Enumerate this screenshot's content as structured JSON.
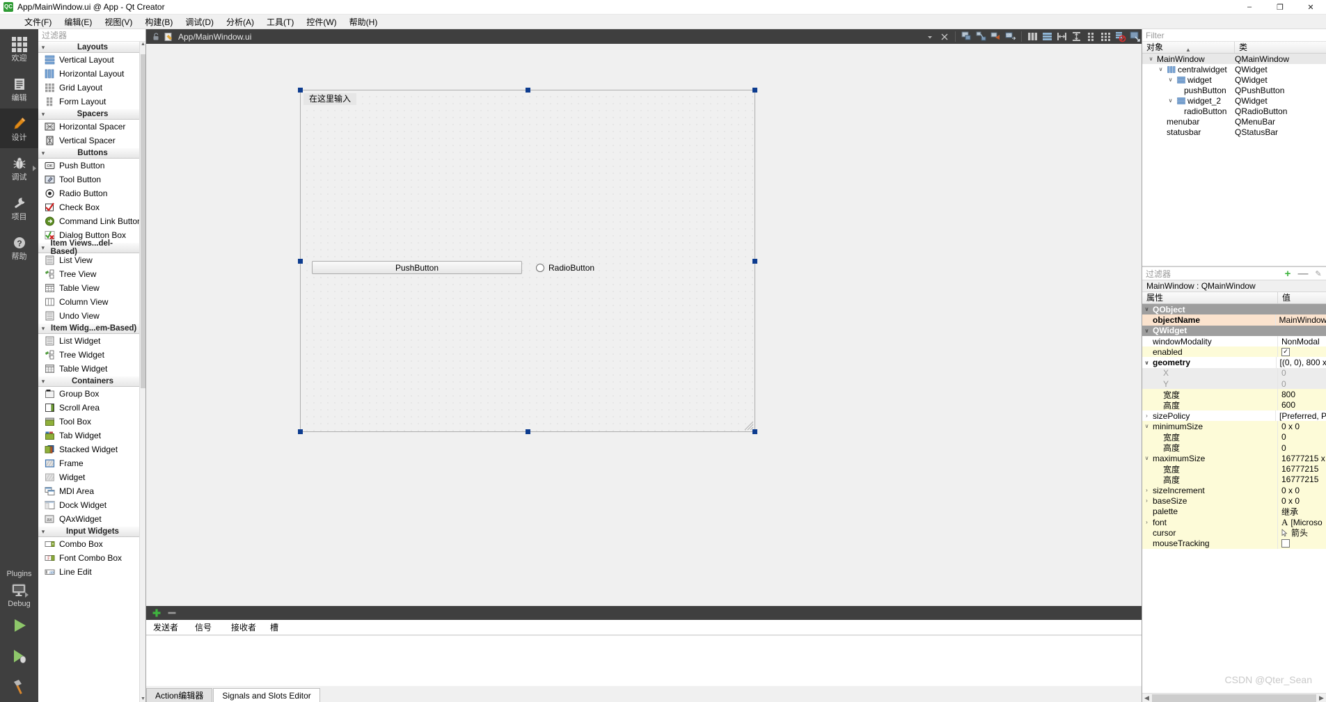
{
  "window": {
    "title": "App/MainWindow.ui @ App - Qt Creator",
    "logo_text": "QC",
    "minimize_label": "–",
    "maximize_label": "❐",
    "close_label": "✕"
  },
  "menubar": [
    {
      "label": "文件(F)"
    },
    {
      "label": "编辑(E)"
    },
    {
      "label": "视图(V)"
    },
    {
      "label": "构建(B)"
    },
    {
      "label": "调试(D)"
    },
    {
      "label": "分析(A)"
    },
    {
      "label": "工具(T)"
    },
    {
      "label": "控件(W)"
    },
    {
      "label": "帮助(H)"
    }
  ],
  "modebar": {
    "items": [
      {
        "label": "欢迎",
        "icon": "grid-icon",
        "active": false,
        "arrow": false
      },
      {
        "label": "编辑",
        "icon": "document-icon",
        "active": false,
        "arrow": false
      },
      {
        "label": "设计",
        "icon": "pencil-icon",
        "active": true,
        "arrow": false
      },
      {
        "label": "调试",
        "icon": "bug-icon",
        "active": false,
        "arrow": true
      },
      {
        "label": "项目",
        "icon": "wrench-icon",
        "active": false,
        "arrow": false
      },
      {
        "label": "帮助",
        "icon": "question-icon",
        "active": false,
        "arrow": false
      }
    ],
    "plugins_label": "Plugins",
    "debug_label": "Debug",
    "run_button": "run-triangle-icon",
    "debug_run_button": "debug-run-icon",
    "build_button": "hammer-icon"
  },
  "widgetbox": {
    "filter_placeholder": "过滤器",
    "categories": [
      {
        "name": "Layouts",
        "items": [
          {
            "label": "Vertical Layout",
            "icon": "vertical-layout-icon"
          },
          {
            "label": "Horizontal Layout",
            "icon": "horizontal-layout-icon"
          },
          {
            "label": "Grid Layout",
            "icon": "grid-layout-icon"
          },
          {
            "label": "Form Layout",
            "icon": "form-layout-icon"
          }
        ]
      },
      {
        "name": "Spacers",
        "items": [
          {
            "label": "Horizontal Spacer",
            "icon": "horizontal-spacer-icon"
          },
          {
            "label": "Vertical Spacer",
            "icon": "vertical-spacer-icon"
          }
        ]
      },
      {
        "name": "Buttons",
        "items": [
          {
            "label": "Push Button",
            "icon": "push-button-icon"
          },
          {
            "label": "Tool Button",
            "icon": "tool-button-icon"
          },
          {
            "label": "Radio Button",
            "icon": "radio-button-icon"
          },
          {
            "label": "Check Box",
            "icon": "check-box-icon"
          },
          {
            "label": "Command Link Button",
            "icon": "command-link-icon"
          },
          {
            "label": "Dialog Button Box",
            "icon": "dialog-button-box-icon"
          }
        ]
      },
      {
        "name": "Item Views...del-Based)",
        "items": [
          {
            "label": "List View",
            "icon": "list-view-icon"
          },
          {
            "label": "Tree View",
            "icon": "tree-view-icon"
          },
          {
            "label": "Table View",
            "icon": "table-view-icon"
          },
          {
            "label": "Column View",
            "icon": "column-view-icon"
          },
          {
            "label": "Undo View",
            "icon": "undo-view-icon"
          }
        ]
      },
      {
        "name": "Item Widg...em-Based)",
        "items": [
          {
            "label": "List Widget",
            "icon": "list-widget-icon"
          },
          {
            "label": "Tree Widget",
            "icon": "tree-widget-icon"
          },
          {
            "label": "Table Widget",
            "icon": "table-widget-icon"
          }
        ]
      },
      {
        "name": "Containers",
        "items": [
          {
            "label": "Group Box",
            "icon": "group-box-icon"
          },
          {
            "label": "Scroll Area",
            "icon": "scroll-area-icon"
          },
          {
            "label": "Tool Box",
            "icon": "tool-box-icon"
          },
          {
            "label": "Tab Widget",
            "icon": "tab-widget-icon"
          },
          {
            "label": "Stacked Widget",
            "icon": "stacked-widget-icon"
          },
          {
            "label": "Frame",
            "icon": "frame-icon"
          },
          {
            "label": "Widget",
            "icon": "widget-icon"
          },
          {
            "label": "MDI Area",
            "icon": "mdi-area-icon"
          },
          {
            "label": "Dock Widget",
            "icon": "dock-widget-icon"
          },
          {
            "label": "QAxWidget",
            "icon": "qax-widget-icon"
          }
        ]
      },
      {
        "name": "Input Widgets",
        "items": [
          {
            "label": "Combo Box",
            "icon": "combo-box-icon"
          },
          {
            "label": "Font Combo Box",
            "icon": "font-combo-box-icon"
          },
          {
            "label": "Line Edit",
            "icon": "line-edit-icon"
          }
        ]
      }
    ]
  },
  "editor": {
    "filename": "App/MainWindow.ui",
    "toolbar_buttons": [
      {
        "name": "dropdown-arrow-icon"
      },
      {
        "name": "close-icon"
      },
      {
        "name": "edit-widgets-icon"
      },
      {
        "name": "edit-signals-slots-icon"
      },
      {
        "name": "edit-buddies-icon"
      },
      {
        "name": "edit-tab-order-icon"
      },
      {
        "name": "layout-horizontally-icon"
      },
      {
        "name": "layout-vertically-icon"
      },
      {
        "name": "layout-splitter-horizontal-icon"
      },
      {
        "name": "layout-splitter-vertical-icon"
      },
      {
        "name": "layout-form-icon"
      },
      {
        "name": "layout-grid-icon"
      },
      {
        "name": "break-layout-icon"
      },
      {
        "name": "adjust-size-icon"
      }
    ]
  },
  "canvas": {
    "menu_placeholder": "在这里输入",
    "push_button_label": "PushButton",
    "radio_button_label": "RadioButton"
  },
  "signals_slots": {
    "add_label": "+",
    "remove_label": "—",
    "columns": [
      "发送者",
      "信号",
      "接收者",
      "槽"
    ]
  },
  "bottom_tabs": [
    {
      "label": "Action编辑器",
      "active": false
    },
    {
      "label": "Signals and Slots Editor",
      "active": true
    }
  ],
  "object_tree": {
    "filter_placeholder": "Filter",
    "columns": [
      "对象",
      "类"
    ],
    "rows": [
      {
        "name": "MainWindow",
        "class": "QMainWindow",
        "depth": 0,
        "expander": "∨",
        "icon": "",
        "selected": true
      },
      {
        "name": "centralwidget",
        "class": "QWidget",
        "depth": 1,
        "expander": "∨",
        "icon": "horizontal-layout-icon",
        "selected": false
      },
      {
        "name": "widget",
        "class": "QWidget",
        "depth": 2,
        "expander": "∨",
        "icon": "vertical-layout-icon",
        "selected": false
      },
      {
        "name": "pushButton",
        "class": "QPushButton",
        "depth": 3,
        "expander": "",
        "icon": "",
        "selected": false
      },
      {
        "name": "widget_2",
        "class": "QWidget",
        "depth": 2,
        "expander": "∨",
        "icon": "vertical-layout-icon",
        "selected": false
      },
      {
        "name": "radioButton",
        "class": "QRadioButton",
        "depth": 3,
        "expander": "",
        "icon": "",
        "selected": false
      },
      {
        "name": "menubar",
        "class": "QMenuBar",
        "depth": 1,
        "expander": "",
        "icon": "",
        "selected": false
      },
      {
        "name": "statusbar",
        "class": "QStatusBar",
        "depth": 1,
        "expander": "",
        "icon": "",
        "selected": false
      }
    ]
  },
  "property_editor": {
    "filter_placeholder": "过滤器",
    "add_button": "+",
    "remove_button": "—",
    "config_button": "✎",
    "object_header": "MainWindow : QMainWindow",
    "columns": [
      "属性",
      "值"
    ],
    "rows": [
      {
        "name": "QObject",
        "value": "",
        "style": "group",
        "expander": "∨",
        "indent": 0,
        "bold": true
      },
      {
        "name": "objectName",
        "value": "MainWindow",
        "style": "orange",
        "expander": "",
        "indent": 1,
        "bold": true
      },
      {
        "name": "QWidget",
        "value": "",
        "style": "group",
        "expander": "∨",
        "indent": 0,
        "bold": true
      },
      {
        "name": "windowModality",
        "value": "NonModal",
        "style": "white",
        "expander": "",
        "indent": 1,
        "bold": false
      },
      {
        "name": "enabled",
        "value": "",
        "style": "yellow",
        "expander": "",
        "indent": 1,
        "bold": false,
        "checkbox": true,
        "checked": true
      },
      {
        "name": "geometry",
        "value": "[(0, 0), 800 x",
        "style": "white",
        "expander": "∨",
        "indent": 0,
        "bold": true
      },
      {
        "name": "X",
        "value": "0",
        "style": "gray",
        "expander": "",
        "indent": 2,
        "bold": false
      },
      {
        "name": "Y",
        "value": "0",
        "style": "gray",
        "expander": "",
        "indent": 2,
        "bold": false
      },
      {
        "name": "宽度",
        "value": "800",
        "style": "yellow",
        "expander": "",
        "indent": 2,
        "bold": false
      },
      {
        "name": "高度",
        "value": "600",
        "style": "yellow",
        "expander": "",
        "indent": 2,
        "bold": false
      },
      {
        "name": "sizePolicy",
        "value": "[Preferred, P",
        "style": "white",
        "expander": "›",
        "indent": 0,
        "bold": false
      },
      {
        "name": "minimumSize",
        "value": "0 x 0",
        "style": "yellow",
        "expander": "∨",
        "indent": 0,
        "bold": false
      },
      {
        "name": "宽度",
        "value": "0",
        "style": "yellow",
        "expander": "",
        "indent": 2,
        "bold": false
      },
      {
        "name": "高度",
        "value": "0",
        "style": "yellow",
        "expander": "",
        "indent": 2,
        "bold": false
      },
      {
        "name": "maximumSize",
        "value": "16777215 x",
        "style": "yellow",
        "expander": "∨",
        "indent": 0,
        "bold": false
      },
      {
        "name": "宽度",
        "value": "16777215",
        "style": "yellow",
        "expander": "",
        "indent": 2,
        "bold": false
      },
      {
        "name": "高度",
        "value": "16777215",
        "style": "yellow",
        "expander": "",
        "indent": 2,
        "bold": false
      },
      {
        "name": "sizeIncrement",
        "value": "0 x 0",
        "style": "yellow",
        "expander": "›",
        "indent": 0,
        "bold": false
      },
      {
        "name": "baseSize",
        "value": "0 x 0",
        "style": "yellow",
        "expander": "›",
        "indent": 0,
        "bold": false
      },
      {
        "name": "palette",
        "value": "继承",
        "style": "yellow",
        "expander": "",
        "indent": 1,
        "bold": false
      },
      {
        "name": "font",
        "value": "[Microso",
        "style": "yellow",
        "expander": "›",
        "indent": 0,
        "bold": false,
        "prefix": "A"
      },
      {
        "name": "cursor",
        "value": "箭头",
        "style": "yellow",
        "expander": "",
        "indent": 1,
        "bold": false,
        "prefix": "cursor-arrow-icon"
      },
      {
        "name": "mouseTracking",
        "value": "",
        "style": "yellow",
        "expander": "",
        "indent": 1,
        "bold": false,
        "checkbox": true,
        "checked": false
      }
    ]
  },
  "watermark": "CSDN @Qter_Sean",
  "colors": {
    "modebar_bg": "#3f3f3f",
    "mode_active_bg": "#2d2d2d",
    "toolbar_bg": "#3f3f3f",
    "accent_green": "#3fb53f",
    "selection_handle": "#0d3c8f",
    "property_yellow": "#fdfbd8",
    "property_orange": "#fbe3ce",
    "group_gray": "#9e9e9e"
  }
}
